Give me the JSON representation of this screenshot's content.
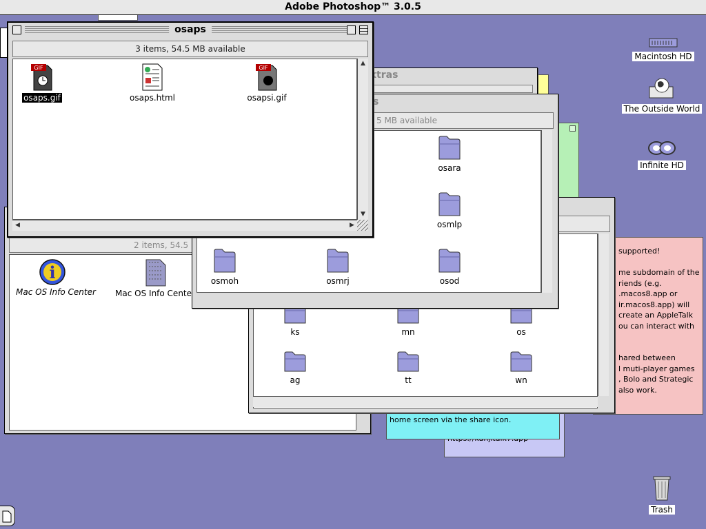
{
  "menubar": {
    "app_title": "Adobe Photoshop™ 3.0.5"
  },
  "windows": {
    "osaps": {
      "title": "osaps",
      "header": "3 items, 54.5 MB available",
      "items": [
        {
          "label": "osaps.gif",
          "icon": "gif-file-icon",
          "selected": true
        },
        {
          "label": "osaps.html",
          "icon": "html-document-icon"
        },
        {
          "label": "osapsi.gif",
          "icon": "gif-file-icon"
        }
      ]
    },
    "left": {
      "header": "2 items, 54.5",
      "items": [
        {
          "label": "Mac OS Info Center",
          "icon": "info-icon"
        },
        {
          "label": "Mac OS Info Center",
          "icon": "document-icon"
        }
      ]
    },
    "extras": {
      "title": "xtras"
    },
    "os": {
      "title": "s",
      "header": "5 MB available",
      "folders": [
        "osara",
        "osmlp",
        "osmoh",
        "osmrj",
        "osod"
      ]
    },
    "back": {
      "folders": [
        "ks",
        "mn",
        "os",
        "ag",
        "tt",
        "wn"
      ]
    }
  },
  "stickies": {
    "pink": [
      "supported!",
      "",
      "me subdomain of the",
      "riends (e.g.",
      ".macos8.app or",
      "ir.macos8.app) will",
      "create an AppleTalk",
      "ou can interact with",
      "",
      "",
      "hared between",
      "l muti-player games",
      ", Bolo and Strategic",
      "also work."
    ],
    "cyan": [
      "home screen via the share icon."
    ],
    "lavender": [
      "https://kanjitalk7.app"
    ]
  },
  "desktop": {
    "icons": [
      "Macintosh HD",
      "The Outside World",
      "Infinite HD",
      "Trash"
    ]
  },
  "colors": {
    "desktop": "#7f7fba",
    "sticky_pink": "#f6c3c3",
    "sticky_cyan": "#7ff0f5",
    "sticky_green": "#b6f0b6",
    "sticky_yellow": "#ffff99",
    "sticky_lavender": "#c8c8f5",
    "folder": "#9c9cdc"
  }
}
